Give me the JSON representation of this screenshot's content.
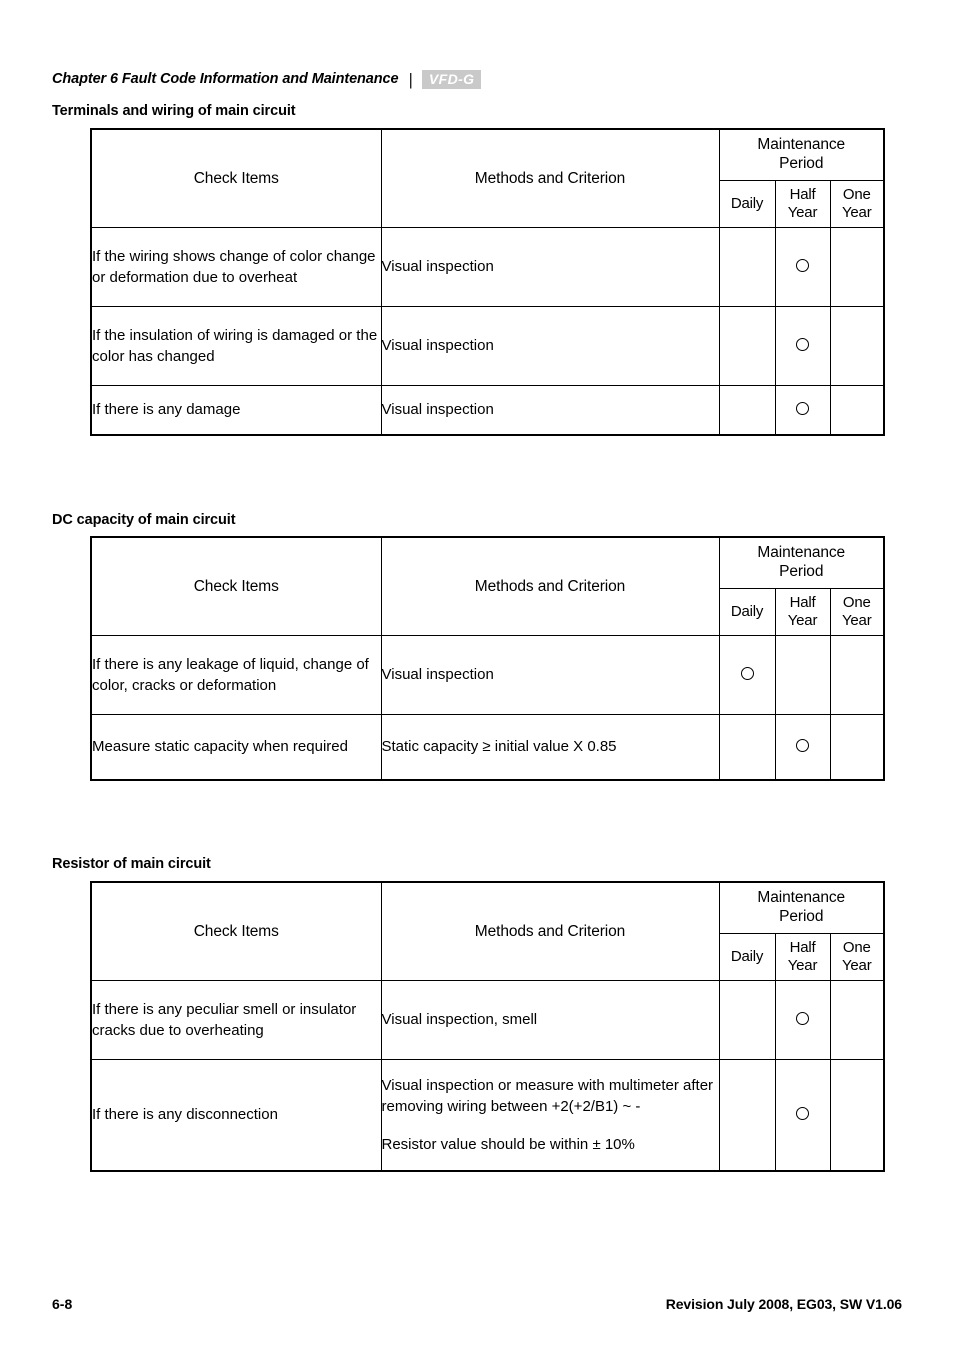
{
  "header": {
    "chapter": "Chapter 6  Fault Code Information and Maintenance",
    "separator": "|",
    "logo_text": "VFD-G",
    "logo_name": "vfd-g-logo"
  },
  "columns": {
    "check_items": "Check Items",
    "methods": "Methods and Criterion",
    "period": "Maintenance\nPeriod",
    "period_line1": "Maintenance",
    "period_line2": "Period",
    "daily": "Daily",
    "half_year_line1": "Half",
    "half_year_line2": "Year",
    "one_year_line1": "One",
    "one_year_line2": "Year"
  },
  "sections": [
    {
      "caption": "Terminals and wiring of main circuit",
      "rows": [
        {
          "check": "If the wiring shows change of color change or deformation due to overheat",
          "method": [
            "Visual inspection"
          ],
          "daily": "",
          "half_year": "○",
          "one_year": ""
        },
        {
          "check": "If the insulation of wiring is damaged or the color has changed",
          "method": [
            "Visual inspection"
          ],
          "daily": "",
          "half_year": "○",
          "one_year": ""
        },
        {
          "check": "If there is any damage",
          "method": [
            "Visual inspection"
          ],
          "daily": "",
          "half_year": "○",
          "one_year": ""
        }
      ]
    },
    {
      "caption": "DC capacity of main circuit",
      "rows": [
        {
          "check": "If there is any leakage of liquid, change of color, cracks or deformation",
          "method": [
            "Visual inspection"
          ],
          "daily": "○",
          "half_year": "",
          "one_year": ""
        },
        {
          "check": "Measure static capacity when required",
          "method": [
            "Static capacity ≥  initial value X 0.85"
          ],
          "daily": "",
          "half_year": "○",
          "one_year": ""
        }
      ]
    },
    {
      "caption": "Resistor of main circuit",
      "rows": [
        {
          "check": "If there is any peculiar smell or insulator cracks due to overheating",
          "method": [
            "Visual inspection, smell"
          ],
          "daily": "",
          "half_year": "○",
          "one_year": ""
        },
        {
          "check": "If there is any disconnection",
          "method": [
            "Visual inspection or measure with multimeter after removing wiring between +2(+2/B1) ~ -",
            "Resistor value should be within ± 10%"
          ],
          "daily": "",
          "half_year": "○",
          "one_year": ""
        }
      ]
    }
  ],
  "footer": {
    "page_number": "6-8",
    "revision": "Revision July 2008, EG03, SW V1.06"
  }
}
